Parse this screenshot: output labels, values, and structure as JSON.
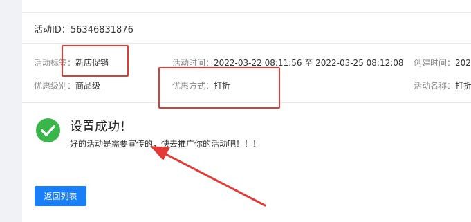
{
  "activity": {
    "id_label": "活动ID：",
    "id_value": "56346831876"
  },
  "details": {
    "tag_label": "活动标签：",
    "tag_value": "新店促销",
    "time_label": "活动时间：",
    "time_value": "2022-03-22 08:11:56 至 2022-03-25 08:12:08",
    "created_label": "创建时间：",
    "created_value": "2022",
    "level_label": "优惠级别：",
    "level_value": "商品级",
    "method_label": "优惠方式：",
    "method_value": "打折",
    "name_label": "活动名称：",
    "name_value": "打折"
  },
  "result": {
    "title": "设置成功！",
    "message": "好的活动是需要宣传的，快去推广你的活动吧！！！",
    "icon": "check-circle-icon"
  },
  "actions": {
    "back_label": "返回列表"
  },
  "colors": {
    "annotation": "#e53935",
    "success": "#39b54a",
    "primary": "#1a7ef7"
  }
}
